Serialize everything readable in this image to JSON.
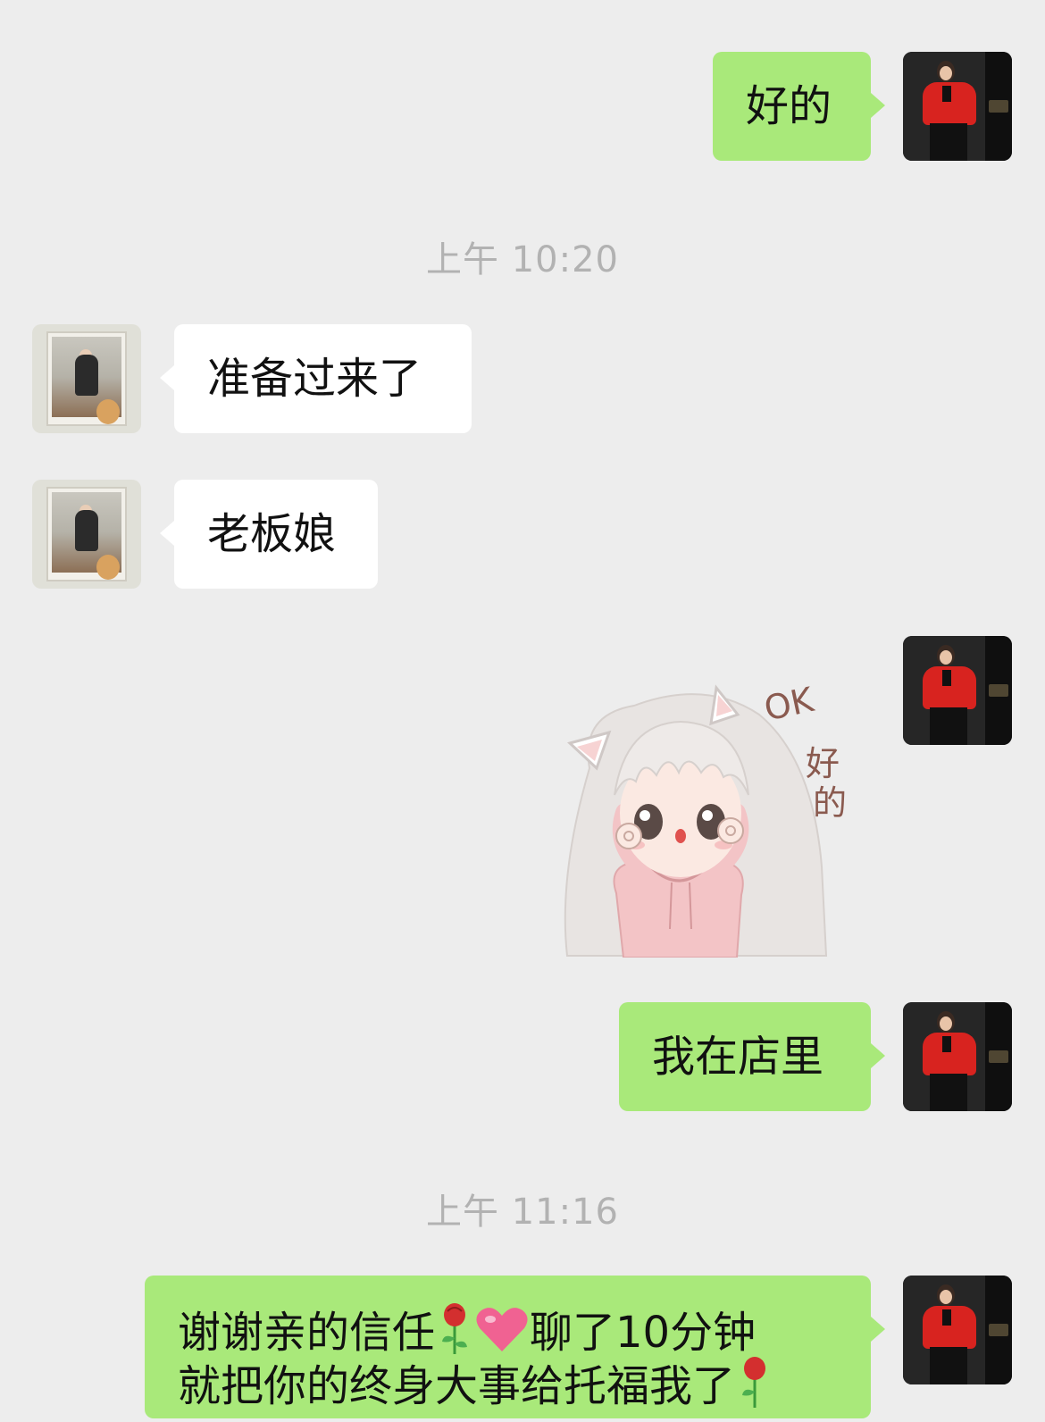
{
  "messages": {
    "m1": {
      "sender": "self",
      "text": "好的"
    },
    "ts1": {
      "text": "上午 10:20"
    },
    "m2": {
      "sender": "other",
      "text": "准备过来了"
    },
    "m3": {
      "sender": "other",
      "text": "老板娘"
    },
    "m4": {
      "sender": "self",
      "type": "sticker",
      "text_ok": "OK",
      "text_hao": "好",
      "text_de": "的"
    },
    "m5": {
      "sender": "self",
      "text": "我在店里"
    },
    "ts2": {
      "text": "上午 11:16"
    },
    "m6": {
      "sender": "self",
      "line1_a": "谢谢亲的信任",
      "line1_b": "聊了10分钟",
      "line2_a": "就把你的终身大事给托福我了",
      "emojis": [
        "rose-emoji",
        "heart-emoji",
        "rose-emoji"
      ]
    }
  },
  "icons": {
    "self_avatar": "avatar-red-blouse-photo",
    "other_avatar": "avatar-framed-photo"
  },
  "colors": {
    "background": "#ededed",
    "self_bubble": "#a9e97a",
    "other_bubble": "#ffffff",
    "timestamp": "#b2b2b2",
    "text": "#111111"
  }
}
